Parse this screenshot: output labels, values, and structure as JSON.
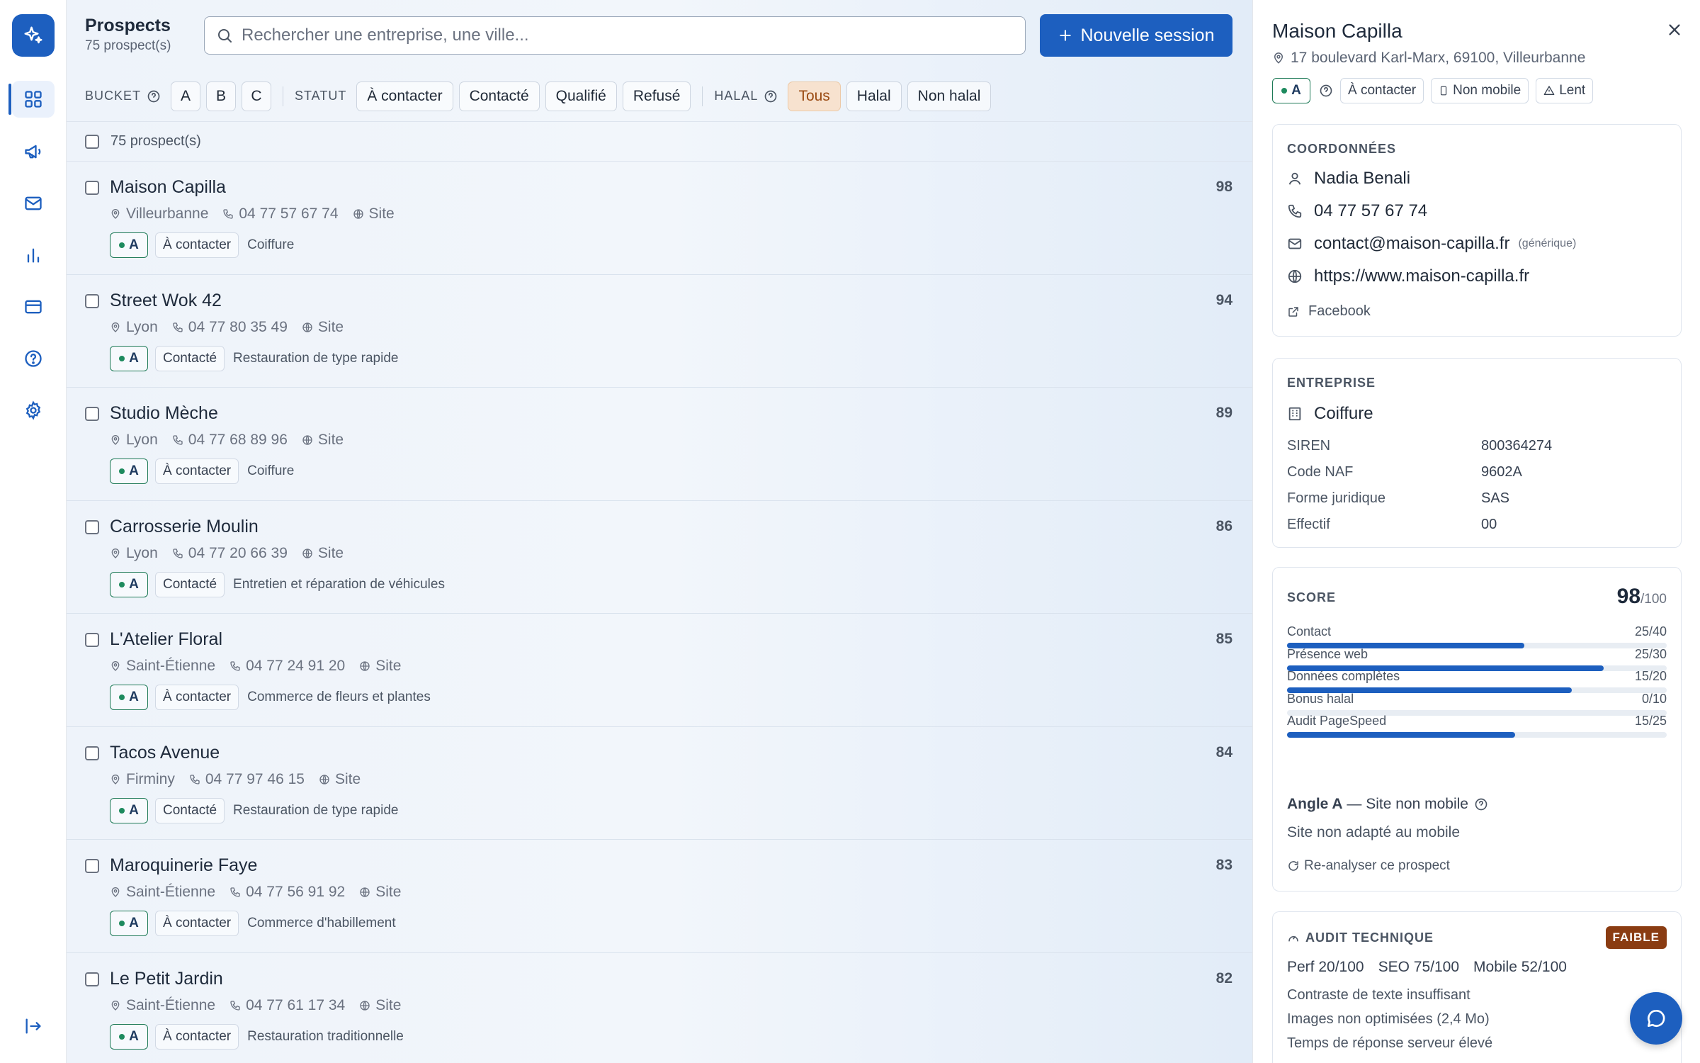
{
  "app": {
    "accent": "#1d5fbf"
  },
  "nav": {
    "items": [
      {
        "icon": "dashboard-icon"
      },
      {
        "icon": "megaphone-icon"
      },
      {
        "icon": "mail-icon"
      },
      {
        "icon": "chart-icon"
      },
      {
        "icon": "card-icon"
      },
      {
        "icon": "help-icon"
      },
      {
        "icon": "settings-icon"
      }
    ],
    "logout_icon": "logout-icon"
  },
  "header": {
    "title": "Prospects",
    "subtitle": "75 prospect(s)",
    "search_placeholder": "Rechercher une entreprise, une ville...",
    "new_session": "Nouvelle session"
  },
  "filters": {
    "bucket_label": "BUCKET",
    "buckets": [
      "A",
      "B",
      "C"
    ],
    "status_label": "STATUT",
    "statuses": [
      "À contacter",
      "Contacté",
      "Qualifié",
      "Refusé"
    ],
    "halal_label": "HALAL",
    "halal": [
      "Tous",
      "Halal",
      "Non halal"
    ],
    "halal_selected": "Tous"
  },
  "list": {
    "select_all_label": "75 prospect(s)",
    "site_label": "Site",
    "rows": [
      {
        "name": "Maison Capilla",
        "city": "Villeurbanne",
        "phone": "04 77 57 67 74",
        "bucket": "A",
        "status": "À contacter",
        "category": "Coiffure",
        "score": "98"
      },
      {
        "name": "Street Wok 42",
        "city": "Lyon",
        "phone": "04 77 80 35 49",
        "bucket": "A",
        "status": "Contacté",
        "category": "Restauration de type rapide",
        "score": "94"
      },
      {
        "name": "Studio Mèche",
        "city": "Lyon",
        "phone": "04 77 68 89 96",
        "bucket": "A",
        "status": "À contacter",
        "category": "Coiffure",
        "score": "89"
      },
      {
        "name": "Carrosserie Moulin",
        "city": "Lyon",
        "phone": "04 77 20 66 39",
        "bucket": "A",
        "status": "Contacté",
        "category": "Entretien et réparation de véhicules",
        "score": "86"
      },
      {
        "name": "L'Atelier Floral",
        "city": "Saint-Étienne",
        "phone": "04 77 24 91 20",
        "bucket": "A",
        "status": "À contacter",
        "category": "Commerce de fleurs et plantes",
        "score": "85"
      },
      {
        "name": "Tacos Avenue",
        "city": "Firminy",
        "phone": "04 77 97 46 15",
        "bucket": "A",
        "status": "Contacté",
        "category": "Restauration de type rapide",
        "score": "84"
      },
      {
        "name": "Maroquinerie Faye",
        "city": "Saint-Étienne",
        "phone": "04 77 56 91 92",
        "bucket": "A",
        "status": "À contacter",
        "category": "Commerce d'habillement",
        "score": "83"
      },
      {
        "name": "Le Petit Jardin",
        "city": "Saint-Étienne",
        "phone": "04 77 61 17 34",
        "bucket": "A",
        "status": "À contacter",
        "category": "Restauration traditionnelle",
        "score": "82"
      }
    ]
  },
  "detail": {
    "name": "Maison Capilla",
    "address": "17 boulevard Karl-Marx, 69100, Villeurbanne",
    "bucket": "A",
    "tags": [
      "À contacter",
      "Non mobile",
      "Lent"
    ],
    "contact": {
      "heading": "COORDONNÉES",
      "person": "Nadia Benali",
      "phone": "04 77 57 67 74",
      "email": "contact@maison-capilla.fr",
      "email_note": "(générique)",
      "website": "https://www.maison-capilla.fr",
      "facebook": "Facebook"
    },
    "company": {
      "heading": "ENTREPRISE",
      "category": "Coiffure",
      "fields": [
        {
          "label": "SIREN",
          "value": "800364274"
        },
        {
          "label": "Code NAF",
          "value": "9602A"
        },
        {
          "label": "Forme juridique",
          "value": "SAS"
        },
        {
          "label": "Effectif",
          "value": "00"
        }
      ]
    },
    "score": {
      "heading": "SCORE",
      "total": "98",
      "max": "/100",
      "components": [
        {
          "label": "Contact",
          "display": "25/40",
          "value": 25,
          "max": 40
        },
        {
          "label": "Présence web",
          "display": "25/30",
          "value": 25,
          "max": 30
        },
        {
          "label": "Données complètes",
          "display": "15/20",
          "value": 15,
          "max": 20
        },
        {
          "label": "Bonus halal",
          "display": "0/10",
          "value": 0,
          "max": 10
        },
        {
          "label": "Audit PageSpeed",
          "display": "15/25",
          "value": 15,
          "max": 25
        }
      ],
      "angle_label": "Angle A",
      "angle_text": " — Site non mobile",
      "angle_desc": "Site non adapté au mobile",
      "reanalyze": "Re-analyser ce prospect"
    },
    "audit": {
      "heading": "AUDIT TECHNIQUE",
      "badge": "FAIBLE",
      "perf": "Perf 20/100",
      "seo": "SEO 75/100",
      "mobile": "Mobile 52/100",
      "issues": [
        "Contraste de texte insuffisant",
        "Images non optimisées (2,4 Mo)",
        "Temps de réponse serveur élevé"
      ]
    }
  }
}
